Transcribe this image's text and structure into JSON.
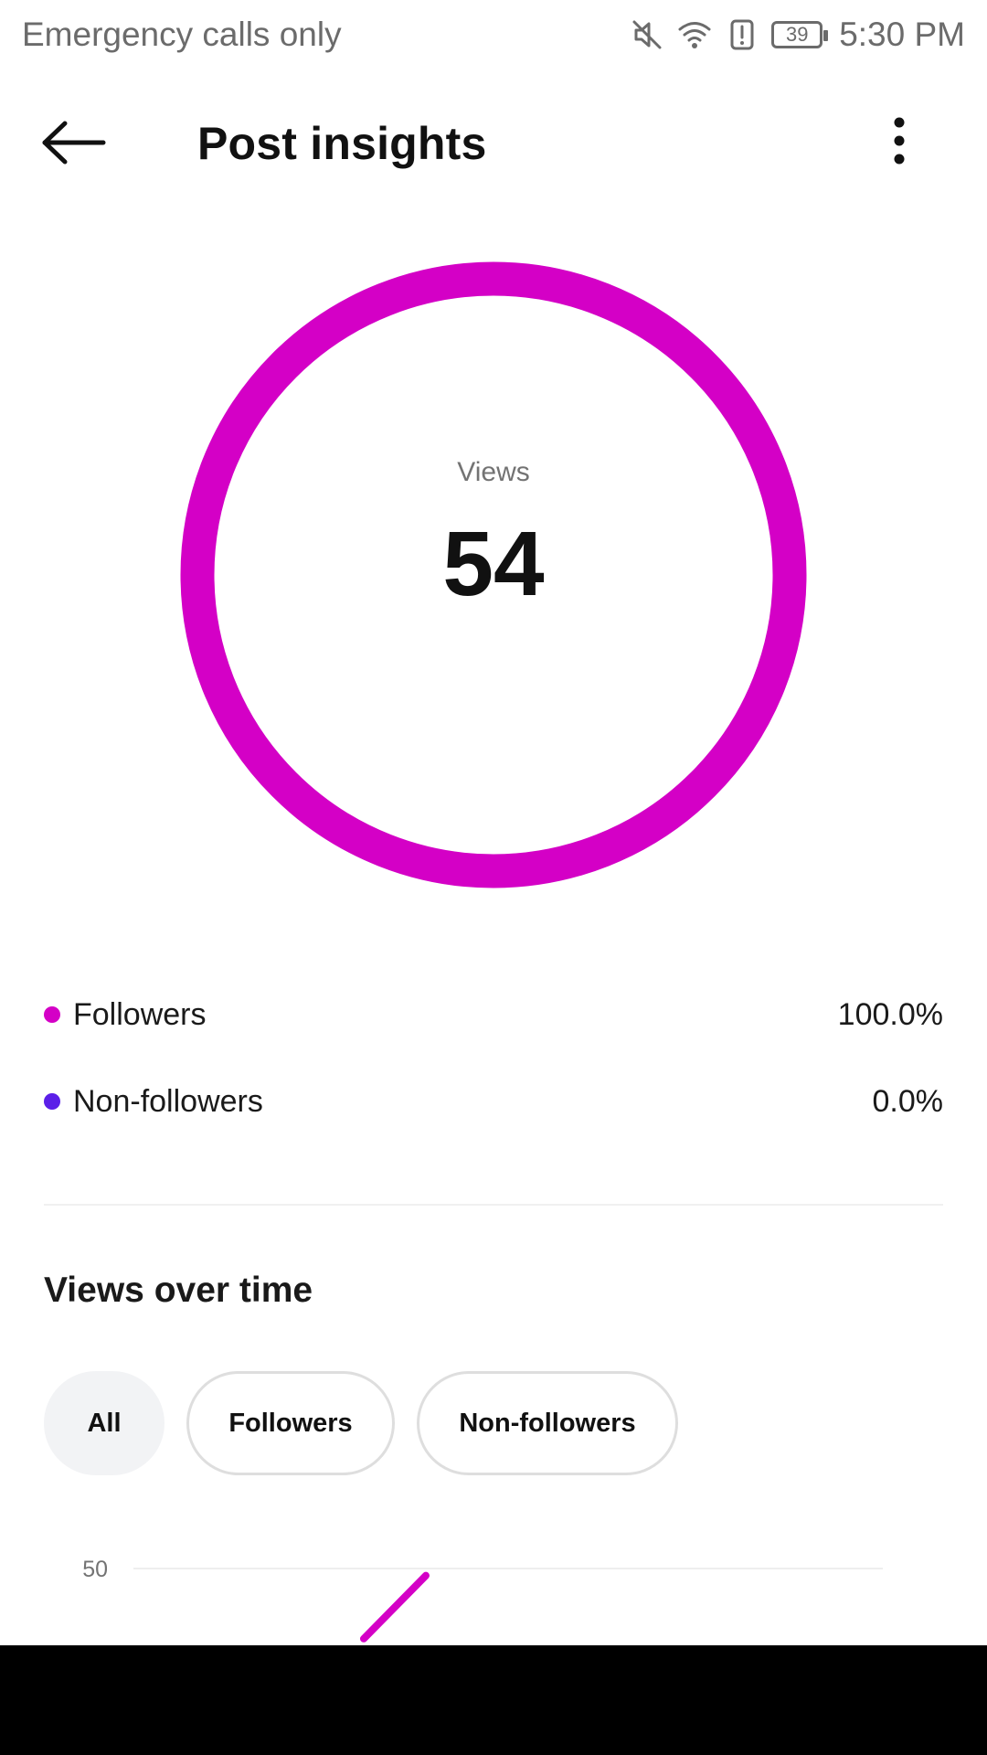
{
  "status_bar": {
    "carrier_text": "Emergency calls only",
    "battery_level": "39",
    "time": "5:30 PM",
    "icons": [
      "mute-icon",
      "wifi-icon",
      "alert-icon",
      "battery-icon"
    ]
  },
  "header": {
    "title": "Post insights",
    "back_icon": "arrow-left-icon",
    "more_icon": "more-vertical-icon"
  },
  "views_ring": {
    "label": "Views",
    "value": "54",
    "followers_fraction": 1.0,
    "ring_color": "#D400C6"
  },
  "audience": [
    {
      "label": "Followers",
      "value": "100.0%",
      "color": "#D400C6"
    },
    {
      "label": "Non-followers",
      "value": "0.0%",
      "color": "#5B1FE8"
    }
  ],
  "views_over_time": {
    "title": "Views over time",
    "filters": [
      {
        "label": "All",
        "active": true
      },
      {
        "label": "Followers",
        "active": false
      },
      {
        "label": "Non-followers",
        "active": false
      }
    ]
  },
  "chart_data": {
    "type": "line",
    "title": "",
    "y_ticks": [
      "50"
    ],
    "ylim": [
      0,
      50
    ],
    "grid": true,
    "series": [
      {
        "color": "#D400C6",
        "values": [
          40,
          49
        ]
      }
    ]
  },
  "colors": {
    "accent": "#D400C6",
    "secondary": "#5B1FE8",
    "chip_active_bg": "#F2F3F5",
    "text_primary": "#111111",
    "text_secondary": "#737373"
  }
}
